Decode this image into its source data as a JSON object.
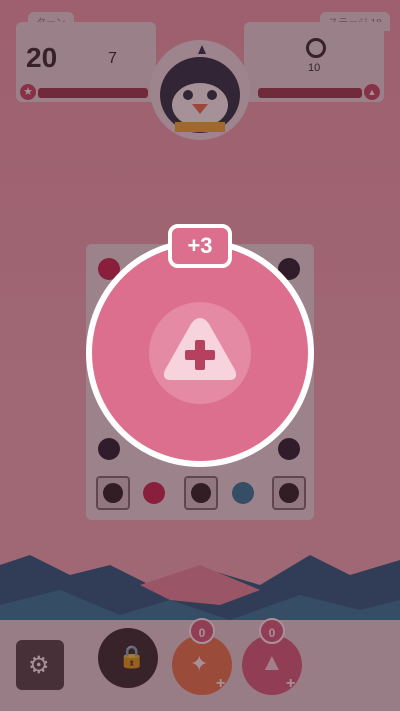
{
  "hud": {
    "turn_tab": "ターン",
    "turns_left": "20",
    "score": "7",
    "stage_tab": "ステージ 18",
    "target_count": "10"
  },
  "popup": {
    "bonus": "+3"
  },
  "bottom": {
    "item1_count": "0",
    "item2_count": "0"
  },
  "colors": {
    "popup": "#dc6f8e",
    "background": "#f0a7b3",
    "mountain": "#1f5f82"
  },
  "icons": [
    "star-icon",
    "triangle-icon",
    "penguin-avatar",
    "ring-icon",
    "gear-icon",
    "lock-icon",
    "bomb-icon",
    "plus-icon"
  ]
}
